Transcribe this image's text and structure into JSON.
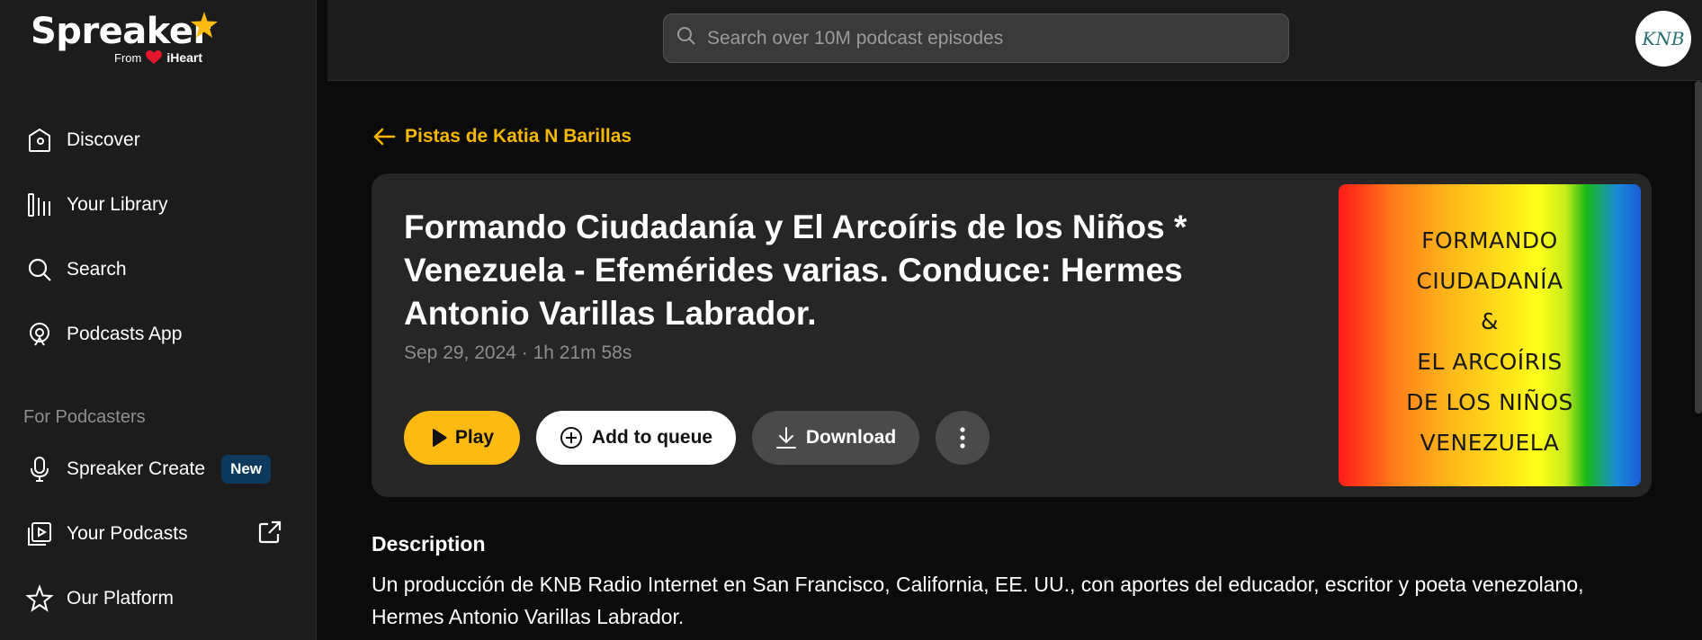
{
  "brand": {
    "name": "Spreaker",
    "sub_from": "From",
    "sub_partner": "iHeart",
    "accent": "#fdba12"
  },
  "sidebar": {
    "nav": [
      {
        "label": "Discover",
        "icon": "discover-icon"
      },
      {
        "label": "Your Library",
        "icon": "library-icon"
      },
      {
        "label": "Search",
        "icon": "search-icon"
      },
      {
        "label": "Podcasts App",
        "icon": "podcasts-app-icon"
      }
    ],
    "section_title": "For Podcasters",
    "podcaster_nav": [
      {
        "label": "Spreaker Create",
        "icon": "microphone-icon",
        "badge": "New"
      },
      {
        "label": "Your Podcasts",
        "icon": "your-podcasts-icon",
        "trailing_icon": "external-link-icon"
      },
      {
        "label": "Our Platform",
        "icon": "star-outline-icon"
      }
    ]
  },
  "header": {
    "search_placeholder": "Search over 10M podcast episodes",
    "avatar_text": "KNB"
  },
  "episode": {
    "back_label": "Pistas de Katia N Barillas",
    "title": "Formando Ciudadanía y El Arcoíris de los Niños * Venezuela - Efemérides varias. Conduce: Hermes Antonio Varillas Labrador.",
    "meta": "Sep 29, 2024 · 1h 21m 58s",
    "actions": {
      "play": "Play",
      "queue": "Add to queue",
      "download": "Download"
    },
    "cover_lines": [
      "FORMANDO",
      "CIUDADANÍA",
      "&",
      "EL ARCOÍRIS",
      "DE LOS NIÑOS",
      "VENEZUELA"
    ]
  },
  "description": {
    "heading": "Description",
    "text": "Un producción de KNB Radio Internet en San Francisco, California, EE. UU., con aportes del educador, escritor y poeta venezolano, Hermes Antonio Varillas Labrador."
  }
}
